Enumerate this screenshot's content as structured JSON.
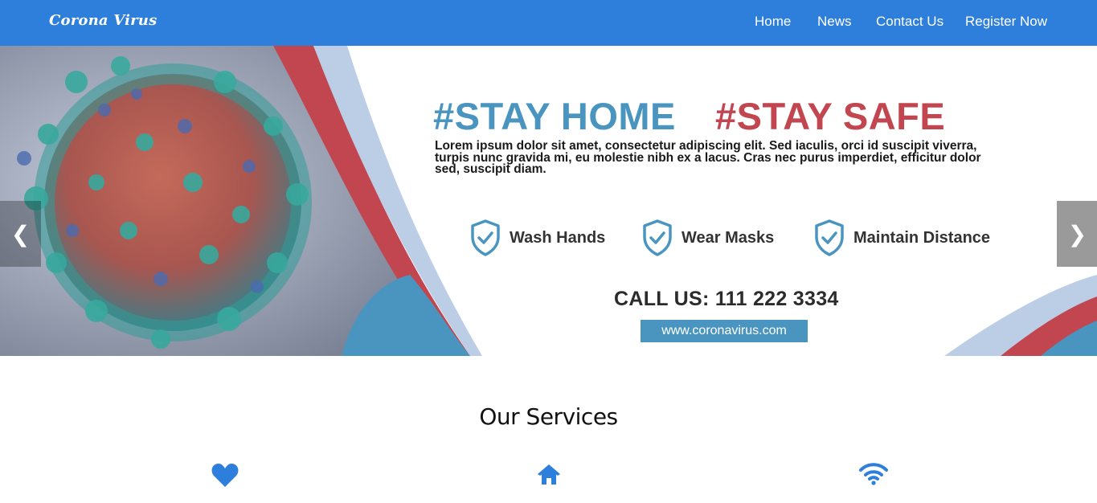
{
  "navbar": {
    "brand": "Corona Virus",
    "links": [
      "Home",
      "News",
      "Contact Us",
      "Register Now"
    ],
    "color": "#2e7fdc"
  },
  "banner": {
    "headline_home": "#STAY HOME",
    "headline_safe": "#STAY SAFE",
    "lorem": "Lorem ipsum dolor sit amet, consectetur adipiscing elit. Sed iaculis, orci id suscipit viverra, turpis nunc gravida mi, eu molestie nibh ex a lacus. Cras nec purus imperdiet, efficitur dolor sed, suscipit diam.",
    "tips": [
      "Wash Hands",
      "Wear Masks",
      "Maintain Distance"
    ],
    "call_us": "CALL US: 111 222 3334",
    "website": "www.coronavirus.com",
    "prev_glyph": "❮",
    "next_glyph": "❯",
    "colors": {
      "blue": "#4a95c0",
      "red": "#c2464f",
      "light_blue": "#bccde6"
    }
  },
  "services": {
    "title": "Our Services",
    "icons": [
      "heart-icon",
      "home-icon",
      "wifi-icon"
    ]
  }
}
